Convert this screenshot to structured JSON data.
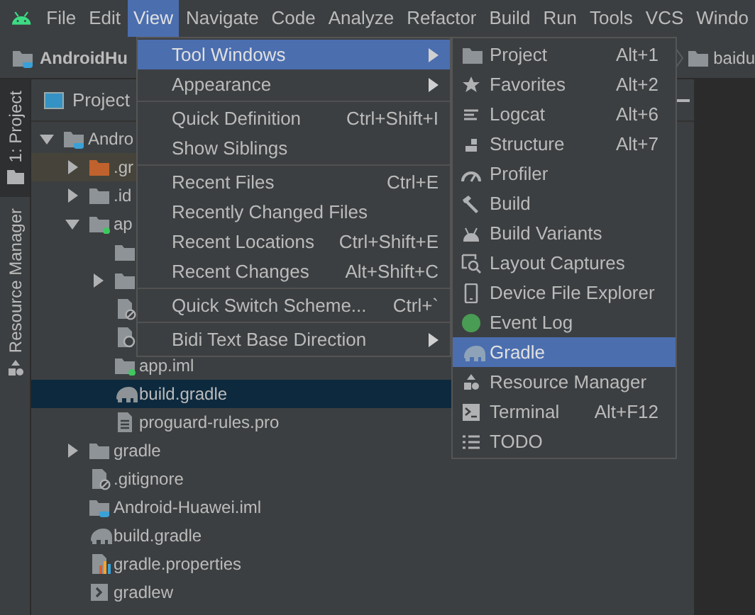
{
  "menu_bar": [
    {
      "label": "File",
      "selected": false
    },
    {
      "label": "Edit",
      "selected": false
    },
    {
      "label": "View",
      "selected": true
    },
    {
      "label": "Navigate",
      "selected": false
    },
    {
      "label": "Code",
      "selected": false
    },
    {
      "label": "Analyze",
      "selected": false
    },
    {
      "label": "Refactor",
      "selected": false
    },
    {
      "label": "Build",
      "selected": false
    },
    {
      "label": "Run",
      "selected": false
    },
    {
      "label": "Tools",
      "selected": false
    },
    {
      "label": "VCS",
      "selected": false
    },
    {
      "label": "Windo",
      "selected": false
    }
  ],
  "nav_bar": {
    "project": "AndroidHu",
    "folder": "baidu"
  },
  "side_tabs": [
    {
      "label": "1: Project",
      "selected": true
    },
    {
      "label": "Resource Manager",
      "selected": false
    }
  ],
  "project_panel": {
    "title": "Project",
    "tree": [
      {
        "name": "Andro",
        "kind": "project",
        "expanded": true,
        "selected": false,
        "children": [
          {
            "name": ".gr",
            "kind": "excluded-folder",
            "expanded": false,
            "selected": false
          },
          {
            "name": ".id",
            "kind": "folder",
            "expanded": false,
            "selected": false
          },
          {
            "name": "ap",
            "kind": "module",
            "expanded": true,
            "selected": false,
            "children": [
              {
                "kind": "folder",
                "selected": false
              },
              {
                "kind": "folder",
                "expanded": false,
                "selected": false
              },
              {
                "kind": "ignored-file",
                "selected": false
              },
              {
                "kind": "config-file",
                "selected": false
              },
              {
                "name": "app.iml",
                "kind": "module-file",
                "selected": false
              },
              {
                "name": "build.gradle",
                "kind": "gradle",
                "selected": true
              },
              {
                "name": "proguard-rules.pro",
                "kind": "text",
                "selected": false
              }
            ]
          },
          {
            "name": "gradle",
            "kind": "folder",
            "expanded": false,
            "selected": false
          },
          {
            "name": ".gitignore",
            "kind": "ignored-file",
            "selected": false
          },
          {
            "name": "Android-Huawei.iml",
            "kind": "project-file",
            "selected": false
          },
          {
            "name": "build.gradle",
            "kind": "gradle",
            "selected": false
          },
          {
            "name": "gradle.properties",
            "kind": "properties",
            "selected": false
          },
          {
            "name": "gradlew",
            "kind": "script",
            "selected": false
          }
        ]
      }
    ]
  },
  "view_menu": [
    {
      "kind": "item",
      "label": "Tool Windows",
      "selected": true,
      "submenu": true
    },
    {
      "kind": "item",
      "label": "Appearance",
      "selected": false,
      "submenu": true
    },
    {
      "kind": "separator"
    },
    {
      "kind": "item",
      "label": "Quick Definition",
      "shortcut": "Ctrl+Shift+I",
      "selected": false,
      "submenu": false
    },
    {
      "kind": "item",
      "label": "Show Siblings",
      "selected": false,
      "submenu": false
    },
    {
      "kind": "separator"
    },
    {
      "kind": "item",
      "label": "Recent Files",
      "shortcut": "Ctrl+E",
      "selected": false,
      "submenu": false
    },
    {
      "kind": "item",
      "label": "Recently Changed Files",
      "selected": false,
      "submenu": false
    },
    {
      "kind": "item",
      "label": "Recent Locations",
      "shortcut": "Ctrl+Shift+E",
      "selected": false,
      "submenu": false
    },
    {
      "kind": "item",
      "label": "Recent Changes",
      "shortcut": "Alt+Shift+C",
      "selected": false,
      "submenu": false
    },
    {
      "kind": "separator"
    },
    {
      "kind": "item",
      "label": "Quick Switch Scheme...",
      "shortcut": "Ctrl+`",
      "selected": false,
      "submenu": false
    },
    {
      "kind": "separator"
    },
    {
      "kind": "item",
      "label": "Bidi Text Base Direction",
      "selected": false,
      "submenu": true
    }
  ],
  "tool_windows_menu": [
    {
      "label": "Project",
      "shortcut": "Alt+1",
      "selected": false
    },
    {
      "label": "Favorites",
      "shortcut": "Alt+2",
      "selected": false
    },
    {
      "label": "Logcat",
      "shortcut": "Alt+6",
      "selected": false
    },
    {
      "label": "Structure",
      "shortcut": "Alt+7",
      "selected": false
    },
    {
      "label": "Profiler",
      "selected": false
    },
    {
      "label": "Build",
      "selected": false
    },
    {
      "label": "Build Variants",
      "selected": false
    },
    {
      "label": "Layout Captures",
      "selected": false
    },
    {
      "label": "Device File Explorer",
      "selected": false
    },
    {
      "label": "Event Log",
      "selected": false
    },
    {
      "label": "Gradle",
      "selected": true
    },
    {
      "label": "Resource Manager",
      "selected": false
    },
    {
      "label": "Terminal",
      "shortcut": "Alt+F12",
      "selected": false
    },
    {
      "label": "TODO",
      "selected": false
    }
  ]
}
